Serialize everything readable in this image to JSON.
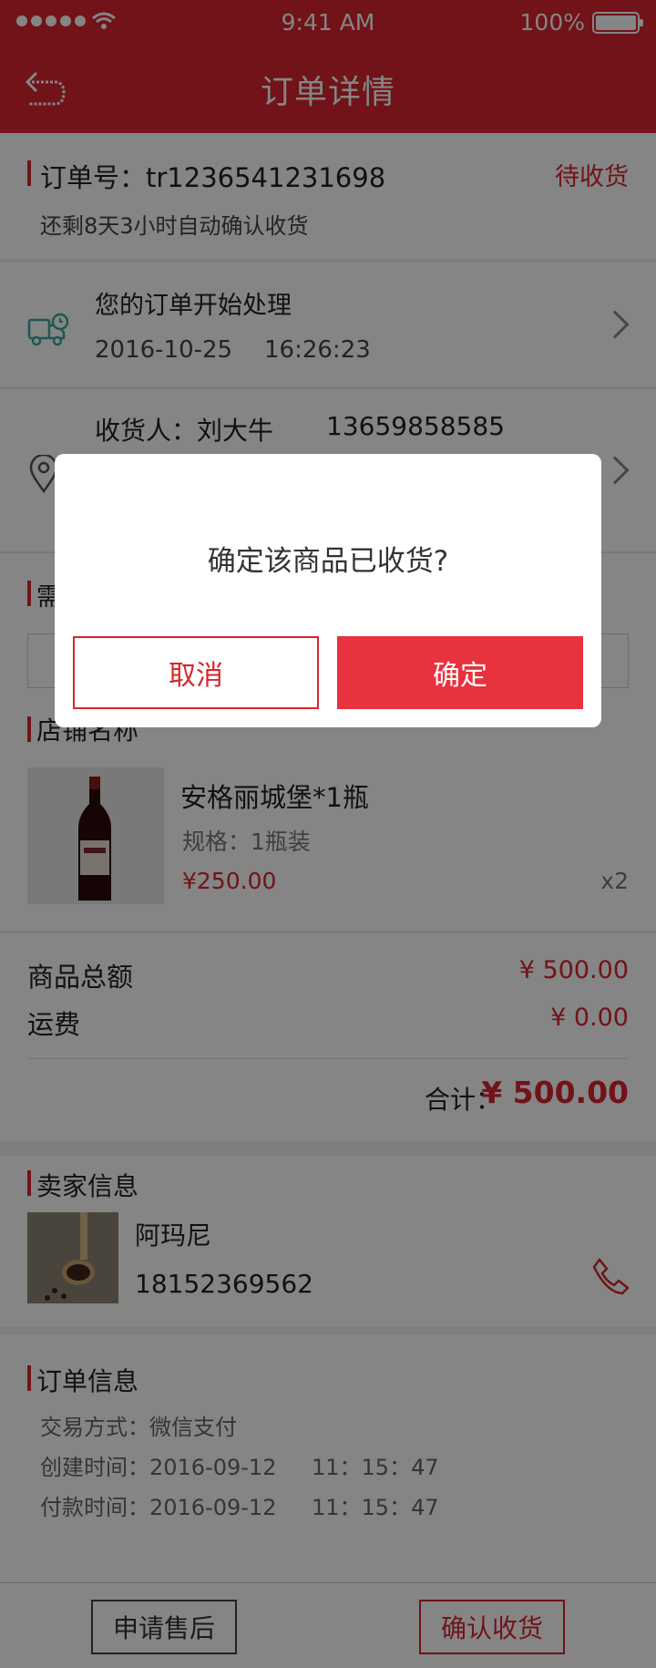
{
  "status_bar": {
    "time": "9:41 AM",
    "battery": "100%"
  },
  "nav": {
    "title": "订单详情"
  },
  "order": {
    "number_label": "订单号：tr1236541231698",
    "status": "待收货",
    "auto_confirm": "还剩8天3小时自动确认收货"
  },
  "logistics": {
    "message": "您的订单开始处理",
    "date": "2016-10-25",
    "time": "16:26:23"
  },
  "receiver": {
    "label": "收货人：刘大牛",
    "phone": "13659858585"
  },
  "remark": {
    "title": "需"
  },
  "shop": {
    "name": "店铺名称",
    "product": {
      "title": "安格丽城堡*1瓶",
      "spec": "规格：1瓶装",
      "price": "¥250.00",
      "qty": "x2"
    }
  },
  "amounts": {
    "goods_label": "商品总额",
    "goods_value": "¥ 500.00",
    "shipping_label": "运费",
    "shipping_value": "¥ 0.00",
    "total_label": "合计：",
    "total_value": "¥ 500.00"
  },
  "seller": {
    "section_title": "卖家信息",
    "name": "阿玛尼",
    "phone": "18152369562"
  },
  "order_info": {
    "section_title": "订单信息",
    "pay_method": "交易方式：微信支付",
    "created": "创建时间：2016-09-12",
    "created_time": "11：15：47",
    "paid": "付款时间：2016-09-12",
    "paid_time": "11：15：47"
  },
  "footer": {
    "after_sale": "申请售后",
    "confirm": "确认收货"
  },
  "dialog": {
    "message": "确定该商品已收货?",
    "cancel": "取消",
    "confirm": "确定"
  },
  "colors": {
    "brand_red": "#d9262e",
    "teal_icon": "#3aa8a0"
  }
}
